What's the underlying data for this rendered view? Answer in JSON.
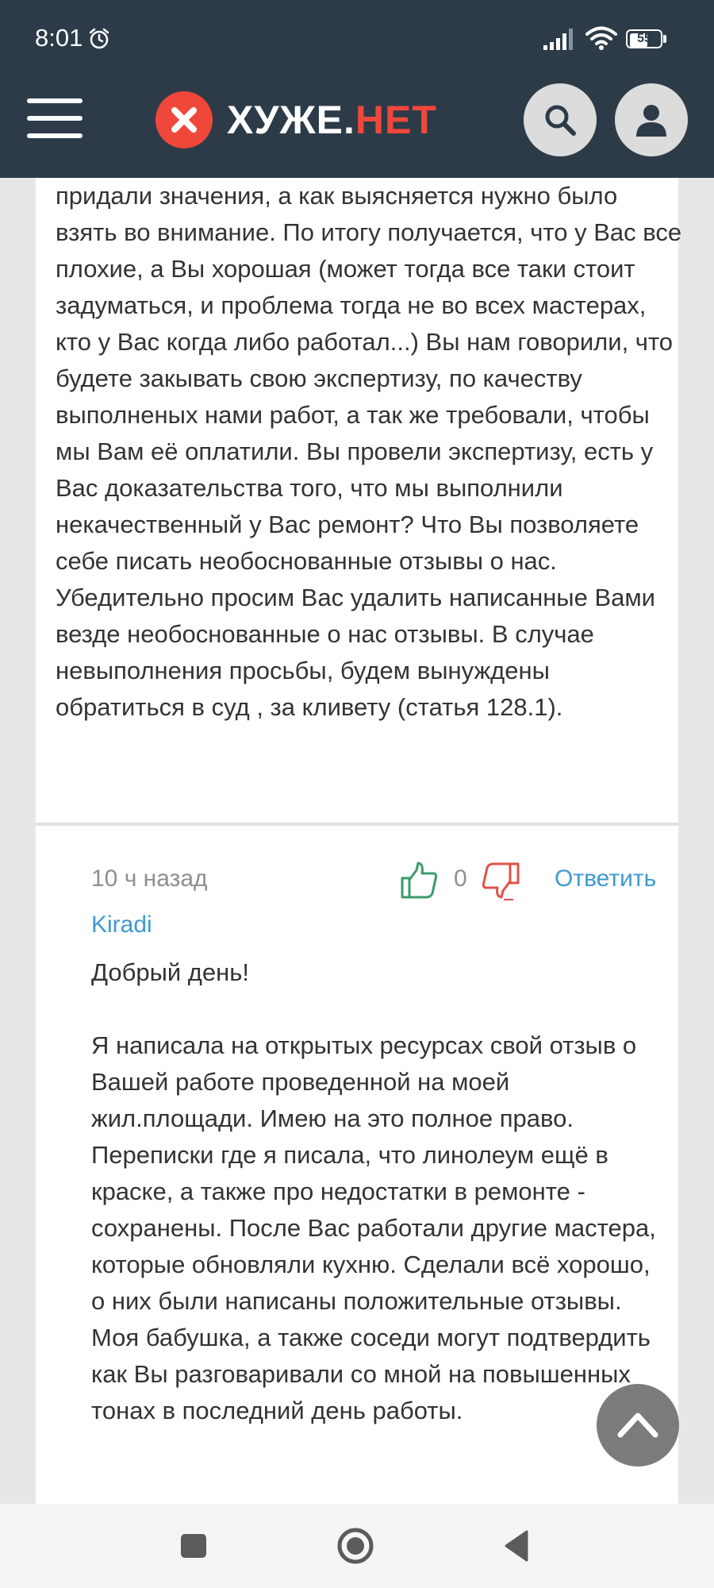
{
  "status_bar": {
    "time": "8:01",
    "battery": "55",
    "icons": [
      "alarm-icon",
      "signal-icon",
      "wifi-icon",
      "battery-icon"
    ]
  },
  "header": {
    "logo_main": "ХУЖЕ",
    "logo_dot": ".",
    "logo_accent": "НЕТ",
    "icons": [
      "menu-icon",
      "logo-x-icon",
      "search-icon",
      "user-icon"
    ],
    "colors": {
      "background": "#2d3b49",
      "accent": "#f0473b"
    }
  },
  "previous_comment": {
    "text": "придали значения, а как выясняется нужно было взять во внимание. По итогу получается, что у Вас все плохие, а Вы хорошая (может тогда все таки стоит задуматься, и проблема тогда не во всех мастерах, кто у Вас когда либо работал...) Вы нам говорили, что будете закывать свою экспертизу, по качеству выполненых нами работ, а так же требовали, чтобы мы Вам её оплатили. Вы провели экспертизу, есть у Вас доказательства того, что мы выполнили некачественный у Вас ремонт? Что Вы позволяете себе писать необоснованные отзывы о нас. Убедительно просим Вас удалить написанные Вами везде необоснованные о нас отзывы. В случае невыполнения просьбы, будем вынуждены обратиться в суд , за кливету (статья 128.1)."
  },
  "comment": {
    "time": "10 ч назад",
    "votes": "0",
    "reply_label": "Ответить",
    "author": "Kiradi",
    "greeting": "Добрый день!",
    "body": "Я написала на открытых ресурсах свой отзыв о Вашей работе проведенной на моей жил.площади. Имею на это полное право. Переписки где я писала, что линолеум ещё в краске, а также про недостатки в ремонте - сохранены. После Вас работали другие мастера, которые обновляли кухню. Сделали всё хорошо, о них были написаны положительные отзывы. Моя бабушка, а также соседи могут подтвердить как Вы разговаривали со мной на повышенных тонах в последний день работы.",
    "icons": [
      "thumbs-up-icon",
      "thumbs-down-icon"
    ],
    "colors": {
      "like": "#3c9b6b",
      "dislike": "#e0524a",
      "link": "#3d9bd1"
    }
  },
  "scroll_top": {
    "icon": "chevron-up-icon"
  },
  "nav_bar": {
    "icons": [
      "recents-square-icon",
      "home-circle-icon",
      "back-triangle-icon"
    ]
  }
}
